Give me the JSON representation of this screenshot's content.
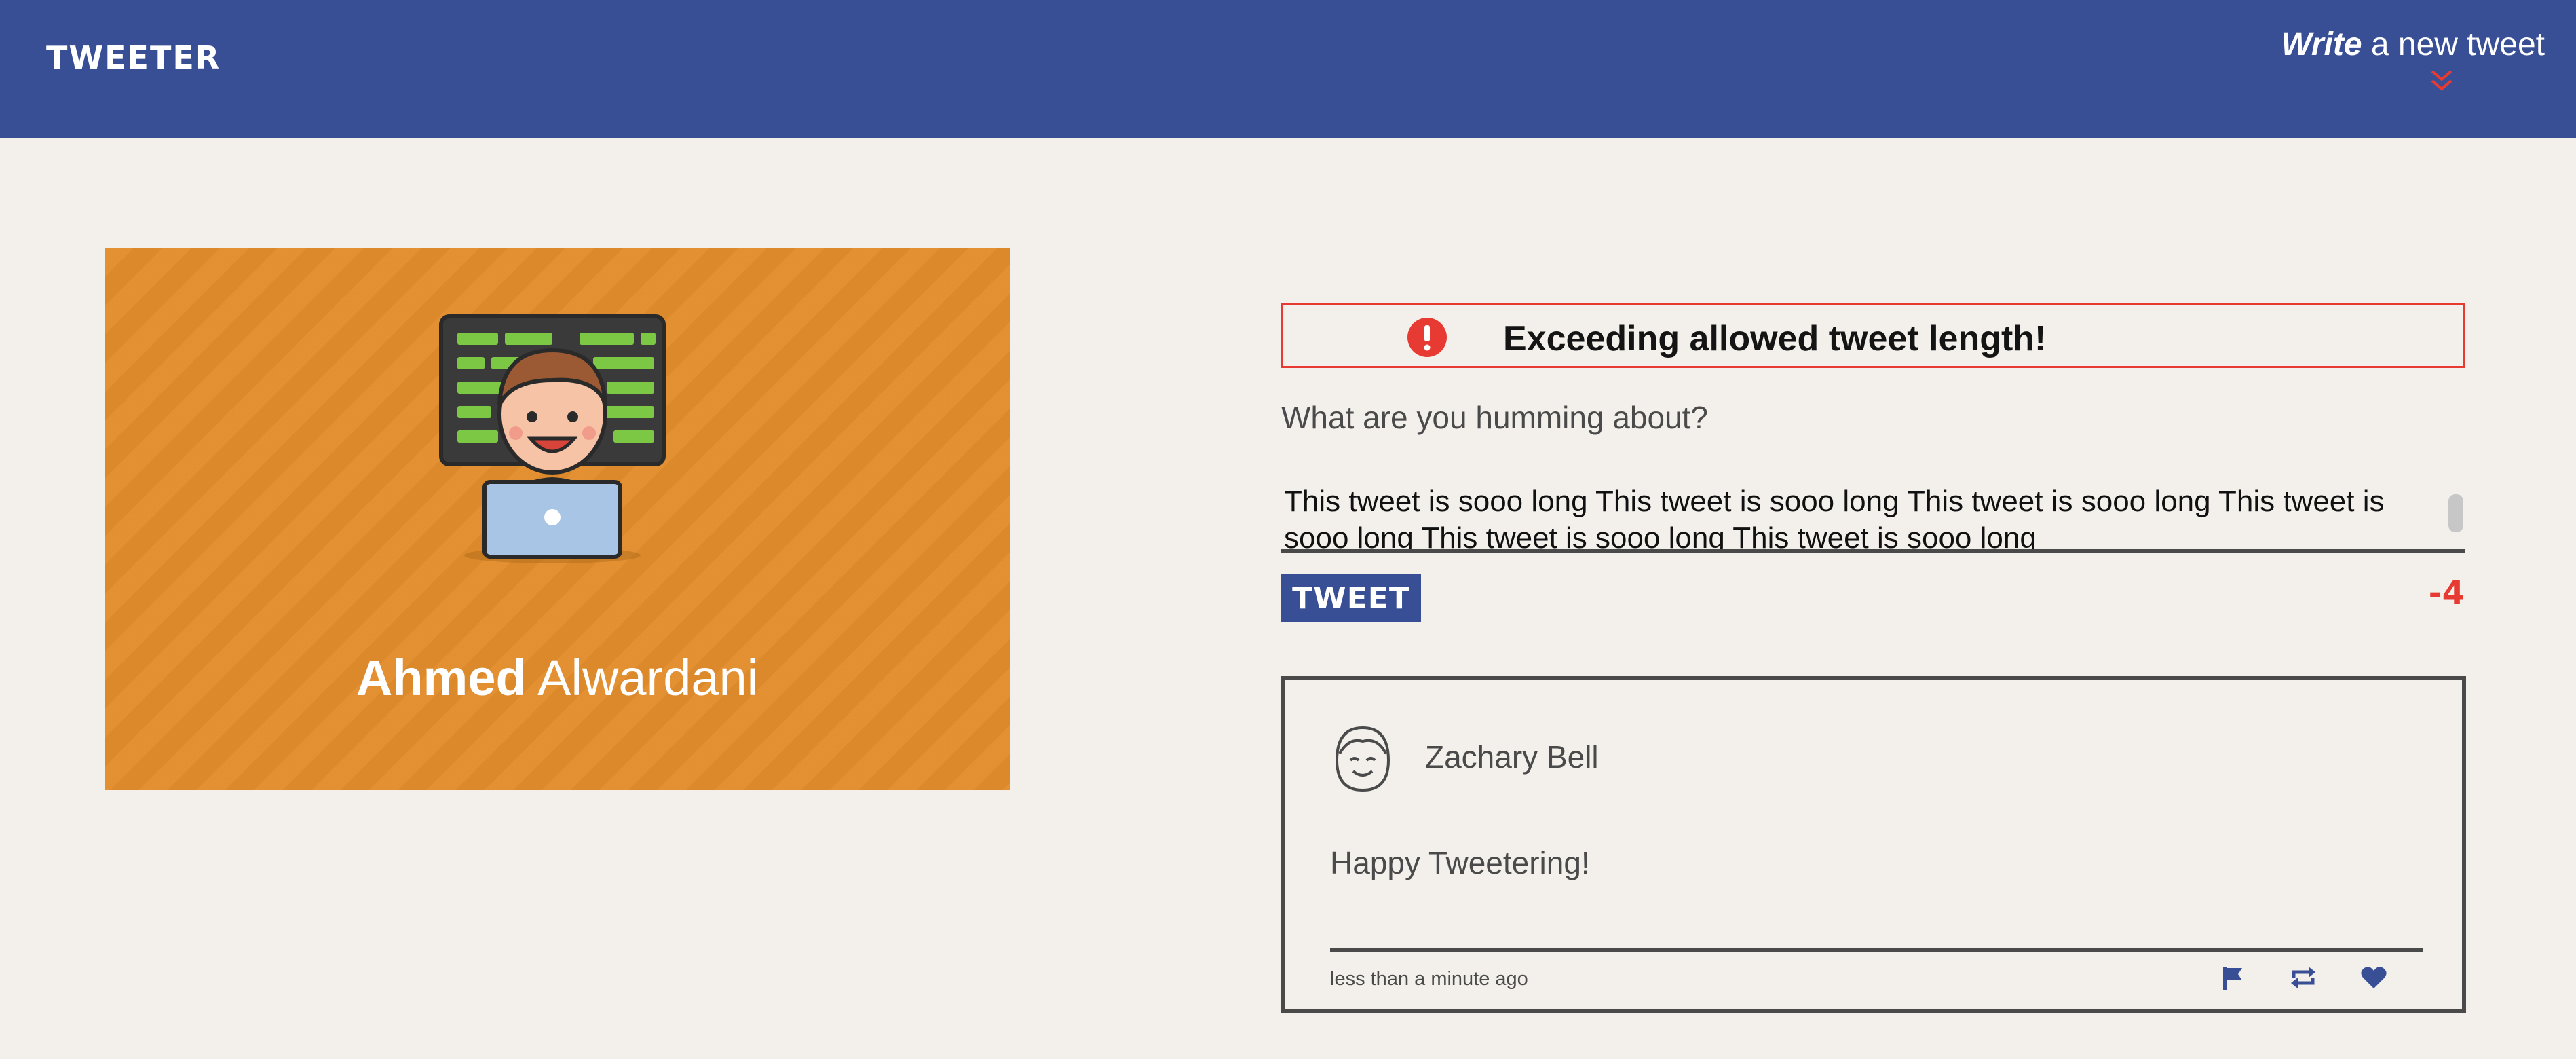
{
  "nav": {
    "logo": "TWEETER",
    "compose_strong": "Write",
    "compose_rest": " a new tweet",
    "accent": "#e63a32",
    "background": "#384f95",
    "toggle_icon": "double-chevron-down-icon"
  },
  "profile": {
    "first_name": "Ahmed",
    "last_name": " Alwardani",
    "background": "#e28d2b",
    "avatar_icon": "developer-avatar-illustration"
  },
  "error": {
    "message": "Exceeding allowed tweet length!",
    "icon": "exclamation-icon",
    "color": "#e63a32"
  },
  "compose": {
    "prompt": "What are you humming about?",
    "text": "This tweet is sooo long This tweet is sooo long This tweet is sooo long This tweet is sooo long This tweet is sooo long This tweet is sooo long ",
    "button_label": "TWEET",
    "char_counter": "-4"
  },
  "tweets": [
    {
      "author": "Zachary Bell",
      "content": "Happy Tweetering!",
      "time": "less than a minute ago",
      "avatar_icon": "face-avatar-icon",
      "actions": [
        "flag-icon",
        "retweet-icon",
        "heart-icon"
      ]
    }
  ]
}
